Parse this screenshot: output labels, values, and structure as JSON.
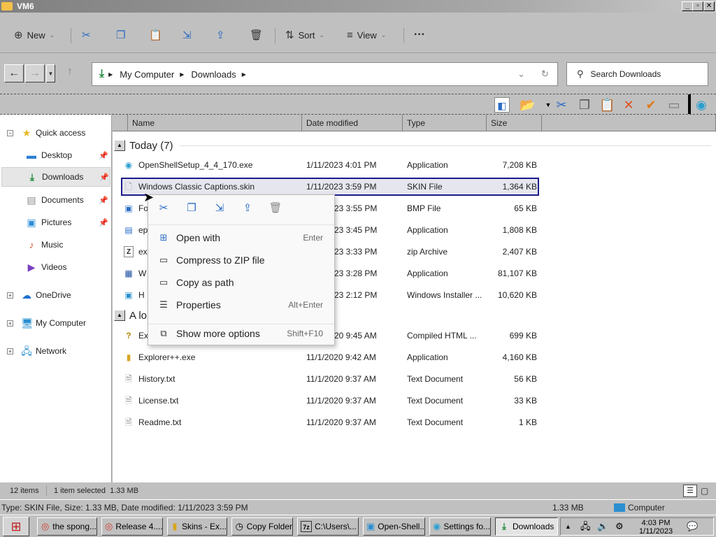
{
  "window": {
    "title": "VM6",
    "minimize_glyph": "_",
    "maximize_glyph": "▫",
    "close_glyph": "✕"
  },
  "command_bar": {
    "new_label": "New",
    "sort_label": "Sort",
    "view_label": "View",
    "more_label": "···",
    "icons": [
      "cut-icon",
      "copy-icon",
      "paste-icon",
      "rename-icon",
      "share-icon",
      "delete-icon"
    ]
  },
  "address": {
    "crumbs": [
      "My Computer",
      "Downloads"
    ],
    "search_placeholder": "Search Downloads"
  },
  "nav": {
    "quick_access": "Quick access",
    "desktop": "Desktop",
    "downloads": "Downloads",
    "documents": "Documents",
    "pictures": "Pictures",
    "music": "Music",
    "videos": "Videos",
    "onedrive": "OneDrive",
    "my_computer": "My Computer",
    "network": "Network"
  },
  "columns": {
    "name": "Name",
    "date": "Date modified",
    "type": "Type",
    "size": "Size"
  },
  "groups": {
    "today": "Today (7)",
    "older": "A lo"
  },
  "files_today": [
    {
      "name": "OpenShellSetup_4_4_170.exe",
      "date": "1/11/2023 4:01 PM",
      "type": "Application",
      "size": "7,208 KB"
    },
    {
      "name": "Windows Classic Captions.skin",
      "date": "1/11/2023 3:59 PM",
      "type": "SKIN File",
      "size": "1,364 KB"
    },
    {
      "name": "Fo",
      "date": "23 3:55 PM",
      "type": "BMP File",
      "size": "65 KB"
    },
    {
      "name": "ep",
      "date": "23 3:45 PM",
      "type": "Application",
      "size": "1,808 KB"
    },
    {
      "name": "ex",
      "date": "23 3:33 PM",
      "type": "zip Archive",
      "size": "2,407 KB"
    },
    {
      "name": "W",
      "date": "23 3:28 PM",
      "type": "Application",
      "size": "81,107 KB"
    },
    {
      "name": "H",
      "date": "23 2:12 PM",
      "type": "Windows Installer ...",
      "size": "10,620 KB"
    }
  ],
  "files_older": [
    {
      "name": "Ex",
      "date": "20 9:45 AM",
      "type": "Compiled HTML ...",
      "size": "699 KB"
    },
    {
      "name": "Explorer++.exe",
      "date": "11/1/2020 9:42 AM",
      "type": "Application",
      "size": "4,160 KB"
    },
    {
      "name": "History.txt",
      "date": "11/1/2020 9:37 AM",
      "type": "Text Document",
      "size": "56 KB"
    },
    {
      "name": "License.txt",
      "date": "11/1/2020 9:37 AM",
      "type": "Text Document",
      "size": "33 KB"
    },
    {
      "name": "Readme.txt",
      "date": "11/1/2020 9:37 AM",
      "type": "Text Document",
      "size": "1 KB"
    }
  ],
  "context_menu": {
    "items": [
      {
        "label": "Open with",
        "key": "Enter"
      },
      {
        "label": "Compress to ZIP file",
        "key": ""
      },
      {
        "label": "Copy as path",
        "key": ""
      },
      {
        "label": "Properties",
        "key": "Alt+Enter"
      },
      {
        "label": "Show more options",
        "key": "Shift+F10"
      }
    ]
  },
  "status": {
    "item_count": "12 items",
    "selection": "1 item selected  1.33 MB",
    "details": "Type: SKIN File, Size: 1.33 MB, Date modified: 1/11/2023 3:59 PM",
    "size": "1.33 MB",
    "location": "Computer"
  },
  "taskbar": {
    "buttons": [
      {
        "label": "the spong...",
        "icon": "chrome-icon"
      },
      {
        "label": "Release 4....",
        "icon": "chrome-icon"
      },
      {
        "label": "Skins - Ex...",
        "icon": "folder-icon"
      },
      {
        "label": "Copy Folder",
        "icon": "clock-icon"
      },
      {
        "label": "C:\\Users\\...",
        "icon": "7zip-icon"
      },
      {
        "label": "Open-Shell...",
        "icon": "window-icon"
      },
      {
        "label": "Settings fo...",
        "icon": "shell-icon"
      },
      {
        "label": "Downloads",
        "icon": "download-icon"
      }
    ],
    "time": "4:03 PM",
    "date": "1/11/2023"
  }
}
